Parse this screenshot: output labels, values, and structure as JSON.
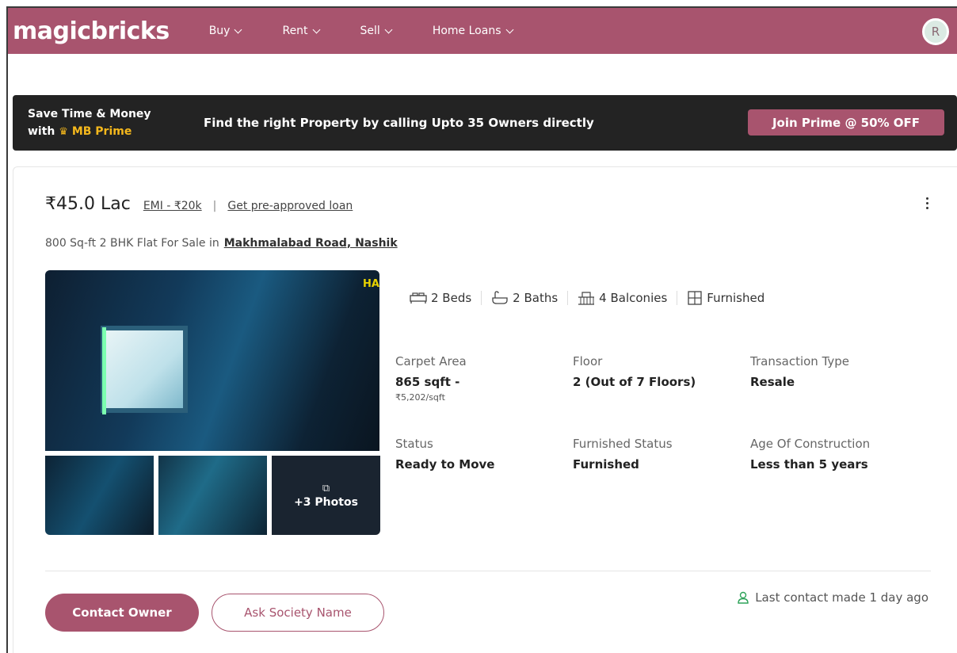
{
  "header": {
    "logo": "magicbricks",
    "nav": [
      {
        "label": "Buy"
      },
      {
        "label": "Rent"
      },
      {
        "label": "Sell"
      },
      {
        "label": "Home Loans"
      }
    ],
    "avatar_initial": "R"
  },
  "prime_banner": {
    "line1": "Save Time & Money",
    "line2_prefix": "with",
    "brand": "MB Prime",
    "message": "Find the right Property by calling Upto 35 Owners directly",
    "cta": "Join Prime @ 50% OFF"
  },
  "listing": {
    "price": "₹45.0 Lac",
    "emi": "EMI - ₹20k",
    "separator": "|",
    "loan_link": "Get pre-approved loan",
    "subtitle": "800 Sq-ft 2 BHK Flat For Sale in",
    "location": "Makhmalabad Road, Nashik",
    "photo_overlay_text": "HA",
    "more_photos": "+3 Photos",
    "amenities": [
      {
        "icon": "bed-icon",
        "label": "2 Beds"
      },
      {
        "icon": "bath-icon",
        "label": "2 Baths"
      },
      {
        "icon": "balcony-icon",
        "label": "4 Balconies"
      },
      {
        "icon": "furnished-icon",
        "label": "Furnished"
      }
    ],
    "specs": [
      {
        "label": "Carpet Area",
        "value": "865 sqft -",
        "sub": "₹5,202/sqft"
      },
      {
        "label": "Floor",
        "value": "2 (Out of 7 Floors)"
      },
      {
        "label": "Transaction Type",
        "value": "Resale"
      },
      {
        "label": "Status",
        "value": "Ready to Move"
      },
      {
        "label": "Furnished Status",
        "value": "Furnished"
      },
      {
        "label": "Age Of Construction",
        "value": "Less than 5 years"
      }
    ],
    "contact_button": "Contact Owner",
    "ask_button": "Ask Society Name",
    "last_contact": "Last contact made 1 day ago"
  },
  "colors": {
    "brand": "#a8546e",
    "banner_bg": "#232323",
    "gold": "#f5b81c"
  }
}
